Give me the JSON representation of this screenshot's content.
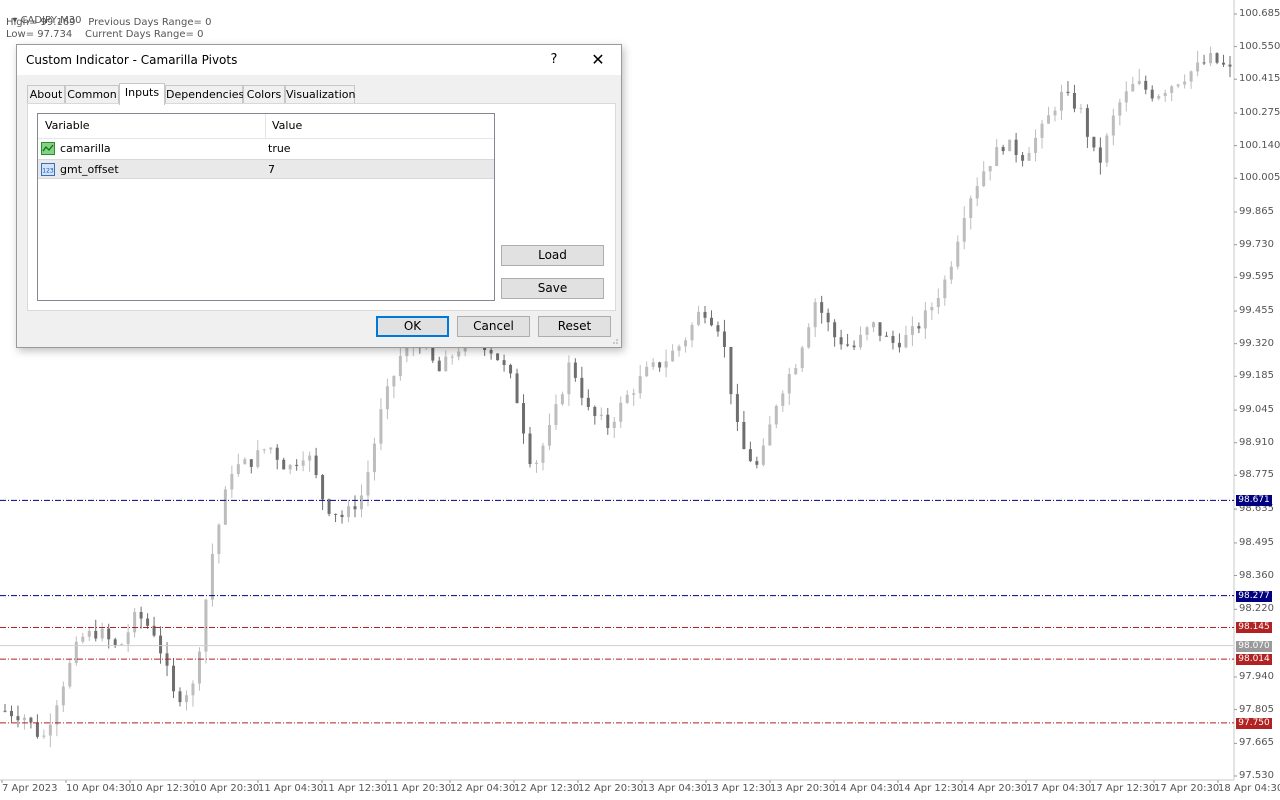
{
  "chart": {
    "symbol": "CADJPY,M30",
    "info_lines": [
      "High= 99.169    Previous Days Range= 0",
      "Low= 97.734    Current Days Range= 0"
    ],
    "price_labels": [
      "100.685",
      "100.550",
      "100.415",
      "100.275",
      "100.140",
      "100.005",
      "99.865",
      "99.730",
      "99.595",
      "99.455",
      "99.320",
      "99.185",
      "99.045",
      "98.910",
      "98.775",
      "98.635",
      "98.495",
      "98.360",
      "98.220",
      "97.940",
      "97.805",
      "97.665",
      "97.530"
    ],
    "price_min": 97.53,
    "price_max": 100.685,
    "levels": [
      {
        "value": "98.671",
        "color": "#000080"
      },
      {
        "value": "98.277",
        "color": "#000080"
      },
      {
        "value": "98.145",
        "color": "#b22222"
      },
      {
        "value": "98.014",
        "color": "#b22222"
      },
      {
        "value": "97.750",
        "color": "#b22222"
      }
    ],
    "current_price": "98.070",
    "time_labels": [
      "7 Apr 2023",
      "10 Apr 04:30",
      "10 Apr 12:30",
      "10 Apr 20:30",
      "11 Apr 04:30",
      "11 Apr 12:30",
      "11 Apr 20:30",
      "12 Apr 04:30",
      "12 Apr 12:30",
      "12 Apr 20:30",
      "13 Apr 04:30",
      "13 Apr 12:30",
      "13 Apr 20:30",
      "14 Apr 04:30",
      "14 Apr 12:30",
      "14 Apr 20:30",
      "17 Apr 04:30",
      "17 Apr 12:30",
      "17 Apr 20:30",
      "18 Apr 04:30"
    ],
    "price_path": [
      97.8,
      97.78,
      97.68,
      97.9,
      98.1,
      98.13,
      98.05,
      98.2,
      98.12,
      97.85,
      97.9,
      98.45,
      98.8,
      98.83,
      98.9,
      98.8,
      98.88,
      98.65,
      98.6,
      98.7,
      99.05,
      99.27,
      99.33,
      99.2,
      99.3,
      99.35,
      99.28,
      99.15,
      98.8,
      98.98,
      99.25,
      99.03,
      98.98,
      99.1,
      99.2,
      99.25,
      99.33,
      99.47,
      99.38,
      98.9,
      98.8,
      99.1,
      99.25,
      99.5,
      99.35,
      99.3,
      99.4,
      99.32,
      99.35,
      99.45,
      99.6,
      99.9,
      100.05,
      100.15,
      100.1,
      100.2,
      100.35,
      100.3,
      100.05,
      100.3,
      100.4,
      100.35,
      100.4,
      100.45,
      100.5,
      100.45
    ]
  },
  "dialog": {
    "title": "Custom Indicator - Camarilla Pivots",
    "help": "?",
    "close": "✕",
    "tabs": [
      "About",
      "Common",
      "Inputs",
      "Dependencies",
      "Colors",
      "Visualization"
    ],
    "active_tab": "Inputs",
    "columns": [
      "Variable",
      "Value"
    ],
    "rows": [
      {
        "name": "camarilla",
        "value": "true",
        "icon": "indicator-icon"
      },
      {
        "name": "gmt_offset",
        "value": "7",
        "icon": "number-123-icon"
      }
    ],
    "buttons": {
      "load": "Load",
      "save": "Save",
      "ok": "OK",
      "cancel": "Cancel",
      "reset": "Reset"
    }
  }
}
